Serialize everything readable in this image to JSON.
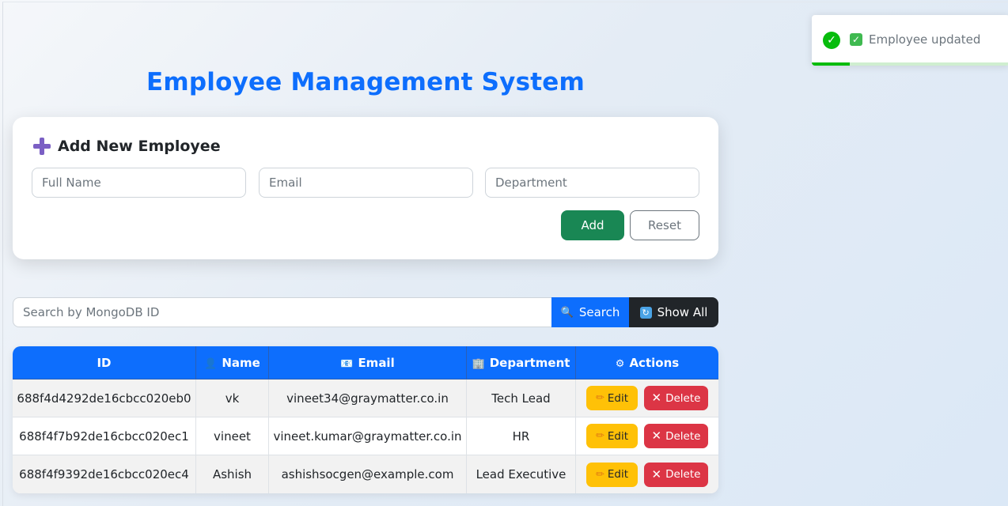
{
  "title": "Employee Management System",
  "form": {
    "header": "Add New Employee",
    "name_placeholder": "Full Name",
    "email_placeholder": "Email",
    "department_placeholder": "Department",
    "add_label": "Add",
    "reset_label": "Reset"
  },
  "search": {
    "placeholder": "Search by MongoDB ID",
    "search_label": "Search",
    "show_all_label": "Show All",
    "search_icon": "magnifier-icon",
    "show_all_icon": "refresh-icon"
  },
  "table": {
    "headers": [
      {
        "label": "ID",
        "icon": ""
      },
      {
        "label": "Name",
        "icon": "user-icon"
      },
      {
        "label": "Email",
        "icon": "envelope-icon"
      },
      {
        "label": "Department",
        "icon": "building-icon"
      },
      {
        "label": "Actions",
        "icon": "gear-icon"
      }
    ],
    "edit_label": "Edit",
    "delete_label": "Delete",
    "rows": [
      {
        "id": "688f4d4292de16cbcc020eb0",
        "name": "vk",
        "email": "vineet34@graymatter.co.in",
        "department": "Tech Lead"
      },
      {
        "id": "688f4f7b92de16cbcc020ec1",
        "name": "vineet",
        "email": "vineet.kumar@graymatter.co.in",
        "department": "HR"
      },
      {
        "id": "688f4f9392de16cbcc020ec4",
        "name": "Ashish",
        "email": "ashishsocgen@example.com",
        "department": "Lead Executive"
      }
    ]
  },
  "toast": {
    "message": "Employee updated",
    "progress": 0.19
  },
  "colors": {
    "primary": "#0d6efd",
    "success": "#198754",
    "warning": "#ffc107",
    "danger": "#dc3545",
    "dark": "#212529"
  }
}
